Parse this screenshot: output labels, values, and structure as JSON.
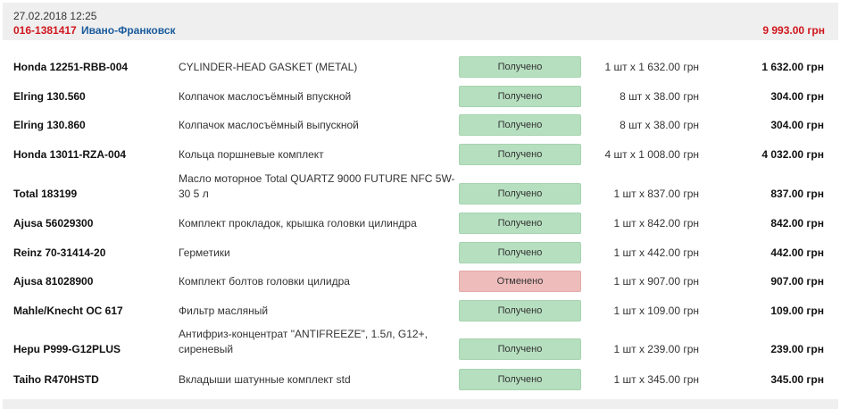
{
  "order": {
    "date": "27.02.2018 12:25",
    "number": "016-1381417",
    "city": "Ивано-Франковск",
    "total": "9 993.00 грн"
  },
  "items": [
    {
      "code": "Honda 12251-RBB-004",
      "name": "CYLINDER-HEAD GASKET (METAL)",
      "status": "Получено",
      "state": "ok",
      "qty": "1 шт x 1 632.00 грн",
      "sum": "1 632.00 грн"
    },
    {
      "code": "Elring 130.560",
      "name": "Колпачок маслосъёмный впускной",
      "status": "Получено",
      "state": "ok",
      "qty": "8 шт x 38.00 грн",
      "sum": "304.00 грн"
    },
    {
      "code": "Elring 130.860",
      "name": "Колпачок маслосъёмный выпускной",
      "status": "Получено",
      "state": "ok",
      "qty": "8 шт x 38.00 грн",
      "sum": "304.00 грн"
    },
    {
      "code": "Honda 13011-RZA-004",
      "name": "Кольца поршневые комплект",
      "status": "Получено",
      "state": "ok",
      "qty": "4 шт x 1 008.00 грн",
      "sum": "4 032.00 грн"
    },
    {
      "code": "Total 183199",
      "name": "Масло моторное Total QUARTZ 9000 FUTURE NFC 5W-30 5 л",
      "status": "Получено",
      "state": "ok",
      "qty": "1 шт x 837.00 грн",
      "sum": "837.00 грн"
    },
    {
      "code": "Ajusa 56029300",
      "name": "Комплект прокладок, крышка головки цилиндра",
      "status": "Получено",
      "state": "ok",
      "qty": "1 шт x 842.00 грн",
      "sum": "842.00 грн"
    },
    {
      "code": "Reinz 70-31414-20",
      "name": "Герметики",
      "status": "Получено",
      "state": "ok",
      "qty": "1 шт x 442.00 грн",
      "sum": "442.00 грн"
    },
    {
      "code": "Ajusa 81028900",
      "name": "Комплект болтов головки цилидра",
      "status": "Отменено",
      "state": "cancel",
      "qty": "1 шт x 907.00 грн",
      "sum": "907.00 грн"
    },
    {
      "code": "Mahle/Knecht OC 617",
      "name": "Фильтр масляный",
      "status": "Получено",
      "state": "ok",
      "qty": "1 шт x 109.00 грн",
      "sum": "109.00 грн"
    },
    {
      "code": "Hepu P999-G12PLUS",
      "name": "Антифриз-концентрат \"ANTIFREEZE\", 1.5л, G12+, сиреневый",
      "status": "Получено",
      "state": "ok",
      "qty": "1 шт x 239.00 грн",
      "sum": "239.00 грн"
    },
    {
      "code": "Taiho R470HSTD",
      "name": "Вкладыши шатунные комплект std",
      "status": "Получено",
      "state": "ok",
      "qty": "1 шт x 345.00 грн",
      "sum": "345.00 грн"
    }
  ]
}
